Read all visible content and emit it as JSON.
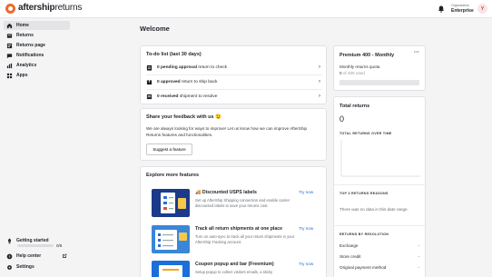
{
  "topbar": {
    "logo_bold": "aftership",
    "logo_light": "returns",
    "org_label": "Organization",
    "org_name": "Enterprise",
    "avatar_initial": "Y"
  },
  "sidebar": {
    "items": [
      {
        "label": "Home",
        "icon": "home-icon",
        "active": true
      },
      {
        "label": "Returns",
        "icon": "returns-icon"
      },
      {
        "label": "Returns page",
        "icon": "returns-page-icon"
      },
      {
        "label": "Notifications",
        "icon": "notifications-icon"
      },
      {
        "label": "Analytics",
        "icon": "analytics-icon"
      },
      {
        "label": "Apps",
        "icon": "apps-icon"
      }
    ],
    "getting_started": "Getting started",
    "progress_count": "0/6",
    "progress_fraction": 0,
    "help_center": "Help center",
    "settings": "Settings"
  },
  "main": {
    "title": "Welcome",
    "todo": {
      "title": "To-do list (last 30 days)",
      "rows": [
        {
          "bold": "0 pending approval",
          "rest": " return to check"
        },
        {
          "bold": "0 approved",
          "rest": " return to ship back"
        },
        {
          "bold": "0 received",
          "rest": " shipment to resolve"
        }
      ]
    },
    "feedback": {
      "title": "Share your feedback with us 😉",
      "text": "We are always looking for ways to improve! Let us know how we can improve AfterShip Returns features and functionalities.",
      "button": "Suggest a feature"
    },
    "explore": {
      "title": "Explore more features",
      "items": [
        {
          "title": "🚚 Discounted USPS labels",
          "desc": "Set up AfterShip Shipping connection and enable carrier discounted labels to save your returns cost.",
          "cta": "Try now"
        },
        {
          "title": "Track all return shipments at one place",
          "desc": "Turn on auto-sync to track all your return shipments in your AfterShip Tracking account.",
          "cta": "Try now"
        },
        {
          "title": "Coupon popup and bar (Freemium)",
          "desc": "Setup popup to collect visitors emails, a sticky",
          "cta": "Try now"
        }
      ]
    }
  },
  "plan": {
    "title": "Premium 400 - Monthly",
    "quota_label": "Monthly returns quota",
    "quota_used": "0",
    "quota_rest": " of 400 used",
    "quota_fraction": 0
  },
  "total_returns": {
    "title": "Total returns",
    "value": "0",
    "over_time_label": "TOTAL RETURNS OVER TIME",
    "top_reasons_label": "TOP 3 RETURNS REASONS",
    "no_data": "There was no data in this date range.",
    "by_resolution_label": "RETURNS BY RESOLUTION",
    "resolutions": [
      {
        "name": "Exchange",
        "value": "-"
      },
      {
        "name": "Store credit",
        "value": "-"
      },
      {
        "name": "Original payment method",
        "value": "-"
      }
    ]
  }
}
